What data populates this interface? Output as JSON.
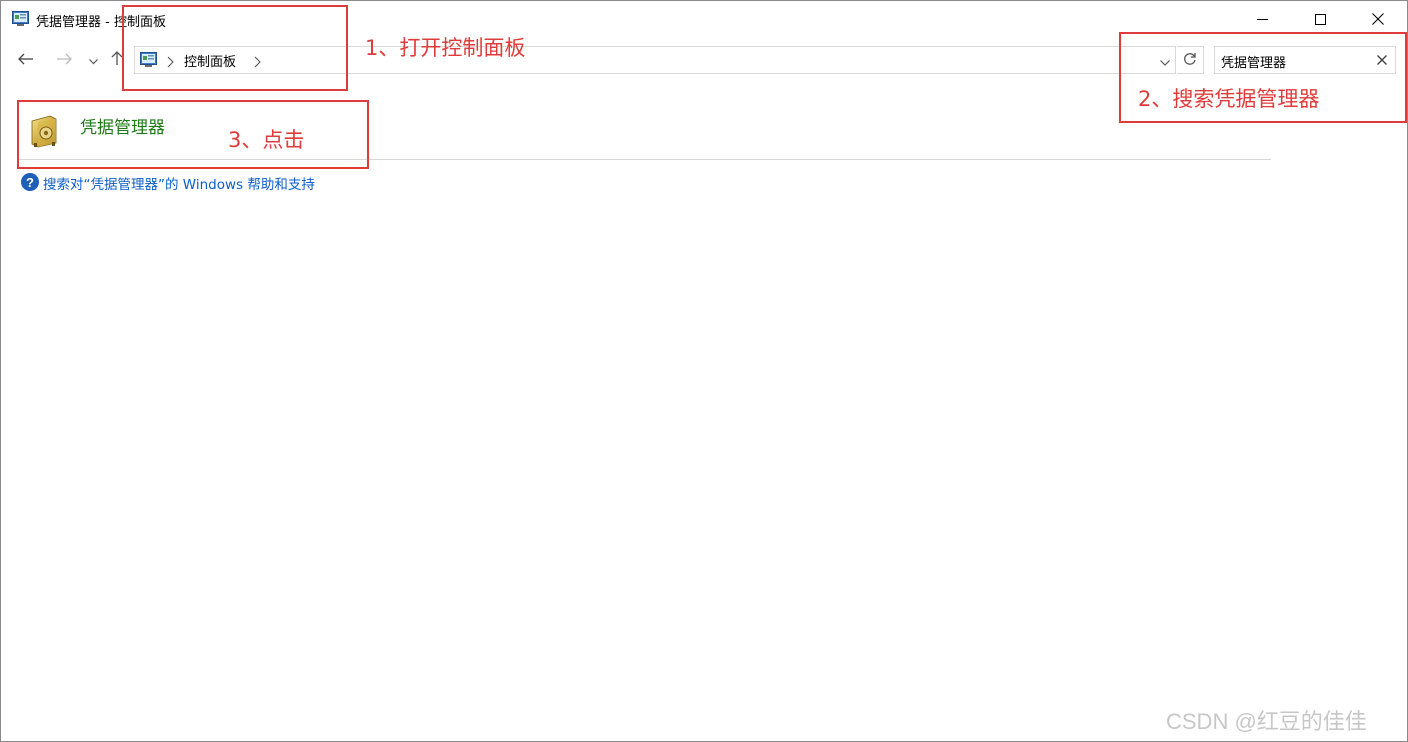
{
  "window": {
    "title": "凭据管理器 - 控制面板",
    "icon": "control-panel-icon"
  },
  "controls": {
    "minimize": "minimize-icon",
    "maximize": "maximize-icon",
    "close": "close-icon"
  },
  "nav": {
    "back": "back-arrow-icon",
    "forward": "forward-arrow-icon",
    "recent": "chevron-down-icon",
    "up": "up-arrow-icon"
  },
  "address": {
    "crumbs": [
      "控制面板"
    ]
  },
  "search": {
    "value": "凭据管理器"
  },
  "result": {
    "title": "凭据管理器",
    "icon": "credential-manager-icon"
  },
  "help": {
    "link": "搜索对“凭据管理器”的 Windows 帮助和支持"
  },
  "annotations": [
    {
      "text": "1、打开控制面板"
    },
    {
      "text": "2、搜索凭据管理器"
    },
    {
      "text": "3、点击"
    }
  ],
  "colors": {
    "annotation": "#e03b3b",
    "result_title": "#1e7b16",
    "link": "#0b5ec8"
  },
  "watermark": "CSDN @红豆的佳佳"
}
